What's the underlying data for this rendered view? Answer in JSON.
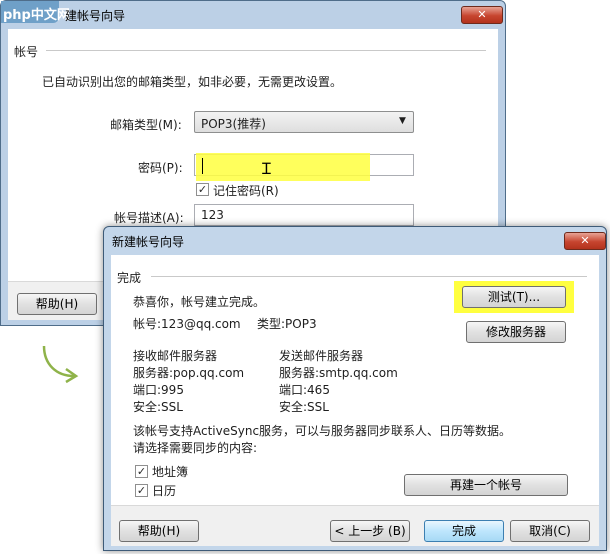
{
  "watermark": "php中文网",
  "back_window": {
    "title": "建帐号向导",
    "section": "帐号",
    "description": "已自动识别出您的邮箱类型，如非必要，无需更改设置。",
    "mailbox_type_label": "邮箱类型(M):",
    "mailbox_type_value": "POP3(推荐)",
    "password_label": "密码(P):",
    "password_value": "",
    "remember_password": "记住密码(R)",
    "remember_checked": true,
    "account_desc_label": "帐号描述(A):",
    "account_desc_value": "123",
    "help_button": "帮助(H)"
  },
  "front_window": {
    "title": "新建帐号向导",
    "section": "完成",
    "congrats": "恭喜你，帐号建立完成。",
    "account": "帐号:123@qq.com",
    "type": "类型:POP3",
    "test_button": "测试(T)...",
    "modify_server_button": "修改服务器",
    "incoming_title": "接收邮件服务器",
    "incoming_server": "服务器:pop.qq.com",
    "incoming_port": "端口:995",
    "incoming_security": "安全:SSL",
    "outgoing_title": "发送邮件服务器",
    "outgoing_server": "服务器:smtp.qq.com",
    "outgoing_port": "端口:465",
    "outgoing_security": "安全:SSL",
    "activesync_note": "该帐号支持ActiveSync服务，可以与服务器同步联系人、日历等数据。",
    "sync_prompt": "请选择需要同步的内容:",
    "sync_items": [
      {
        "label": "地址簿",
        "checked": true
      },
      {
        "label": "日历",
        "checked": true
      }
    ],
    "new_account_button": "再建一个帐号",
    "help_button": "帮助(H)",
    "back_button": "< 上一步 (B)",
    "finish_button": "完成",
    "cancel_button": "取消(C)"
  },
  "colors": {
    "highlight": "#ffff3f",
    "arrow": "#8fb34a",
    "titlebar": "#bcd0e6"
  }
}
